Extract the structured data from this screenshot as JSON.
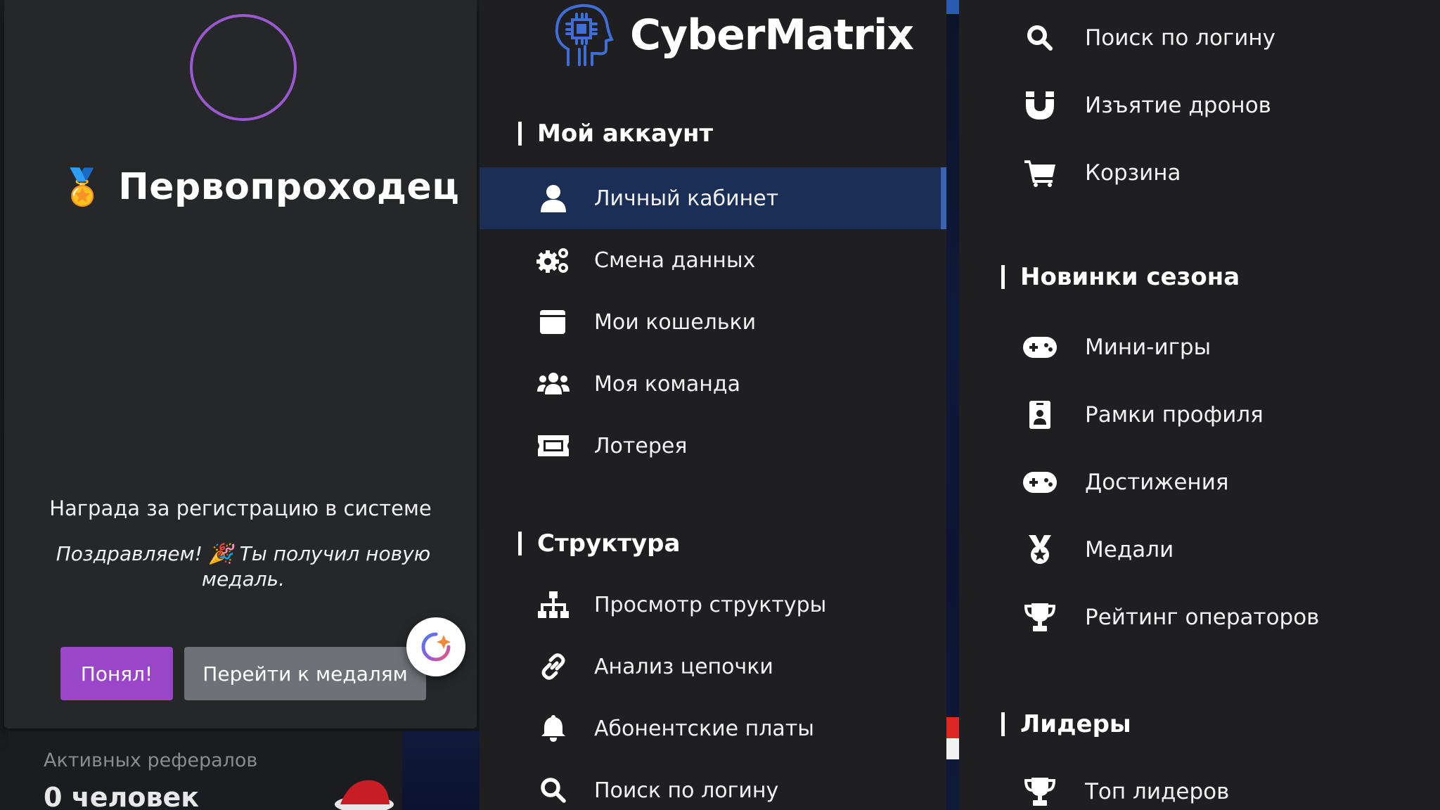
{
  "modal": {
    "medal_emoji": "🏅",
    "title": "Первопроходец",
    "subtitle": "Награда за регистрацию в системе",
    "message": "Поздравляем! 🎉 Ты получил новую медаль.",
    "ok_label": "Понял!",
    "medals_label": "Перейти к медалям",
    "ring_color": "#9b59d0",
    "ok_color": "#9a46c8"
  },
  "referrals": {
    "label": "Активных рефералов",
    "value": "0 человек"
  },
  "logo": {
    "text": "CyberMatrix",
    "icon": "robot-chip-head-icon"
  },
  "nav": {
    "sections": [
      {
        "title": "Мой аккаунт",
        "items": [
          {
            "label": "Личный кабинет",
            "icon": "user-icon",
            "active": true
          },
          {
            "label": "Смена данных",
            "icon": "gears-icon"
          },
          {
            "label": "Мои кошельки",
            "icon": "wallet-icon"
          },
          {
            "label": "Моя команда",
            "icon": "users-icon"
          },
          {
            "label": "Лотерея",
            "icon": "ticket-icon"
          }
        ]
      },
      {
        "title": "Структура",
        "items": [
          {
            "label": "Просмотр структуры",
            "icon": "sitemap-icon"
          },
          {
            "label": "Анализ цепочки",
            "icon": "link-icon"
          },
          {
            "label": "Абонентские платы",
            "icon": "bell-icon"
          },
          {
            "label": "Поиск по логину",
            "icon": "search-icon"
          }
        ]
      }
    ]
  },
  "right_nav": {
    "top_items": [
      {
        "label": "Поиск по логину",
        "icon": "search-icon"
      },
      {
        "label": "Изъятие дронов",
        "icon": "magnet-icon"
      },
      {
        "label": "Корзина",
        "icon": "cart-icon"
      }
    ],
    "season": {
      "title": "Новинки сезона",
      "items": [
        {
          "label": "Мини-игры",
          "icon": "gamepad-icon"
        },
        {
          "label": "Рамки профиля",
          "icon": "id-badge-icon"
        },
        {
          "label": "Достижения",
          "icon": "gamepad-icon"
        },
        {
          "label": "Медали",
          "icon": "medal-icon"
        },
        {
          "label": "Рейтинг операторов",
          "icon": "trophy-icon"
        }
      ]
    },
    "leaders": {
      "title": "Лидеры",
      "items": [
        {
          "label": "Топ лидеров",
          "icon": "trophy-icon"
        }
      ]
    }
  },
  "colors": {
    "active_item_bg": "#1b2e55",
    "active_item_accent": "#3a63b0",
    "panel_bg": "#1f1f21"
  }
}
